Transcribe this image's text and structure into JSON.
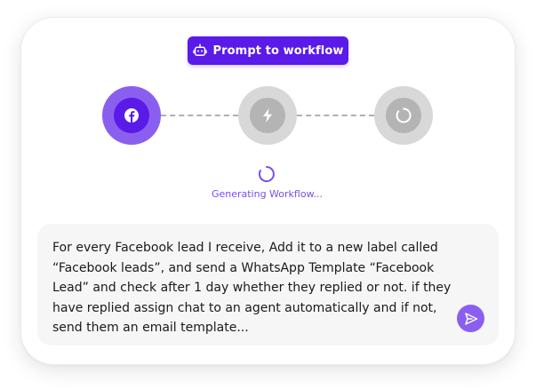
{
  "header": {
    "button_label": "Prompt to workflow",
    "button_icon": "robot-icon",
    "accent_color": "#5a1ae8"
  },
  "steps": [
    {
      "icon": "facebook-icon",
      "state": "active",
      "color": "#5a1ae8"
    },
    {
      "icon": "lightning-icon",
      "state": "pending",
      "color": "#b4b4b4"
    },
    {
      "icon": "loading-icon",
      "state": "pending",
      "color": "#b4b4b4"
    }
  ],
  "status": {
    "text": "Generating Workflow...",
    "icon": "spinner-icon",
    "color": "#7a4cf0"
  },
  "prompt": {
    "lines": [
      "For every Facebook lead I receive, Add it to a new label called",
      "“Facebook leads”, and send a WhatsApp Template “Facebook",
      "Lead” and check after 1 day whether they replied or not. if they",
      "have replied assign chat to an agent automatically and if not,",
      "send them an email template..."
    ],
    "send_icon": "send-icon"
  }
}
